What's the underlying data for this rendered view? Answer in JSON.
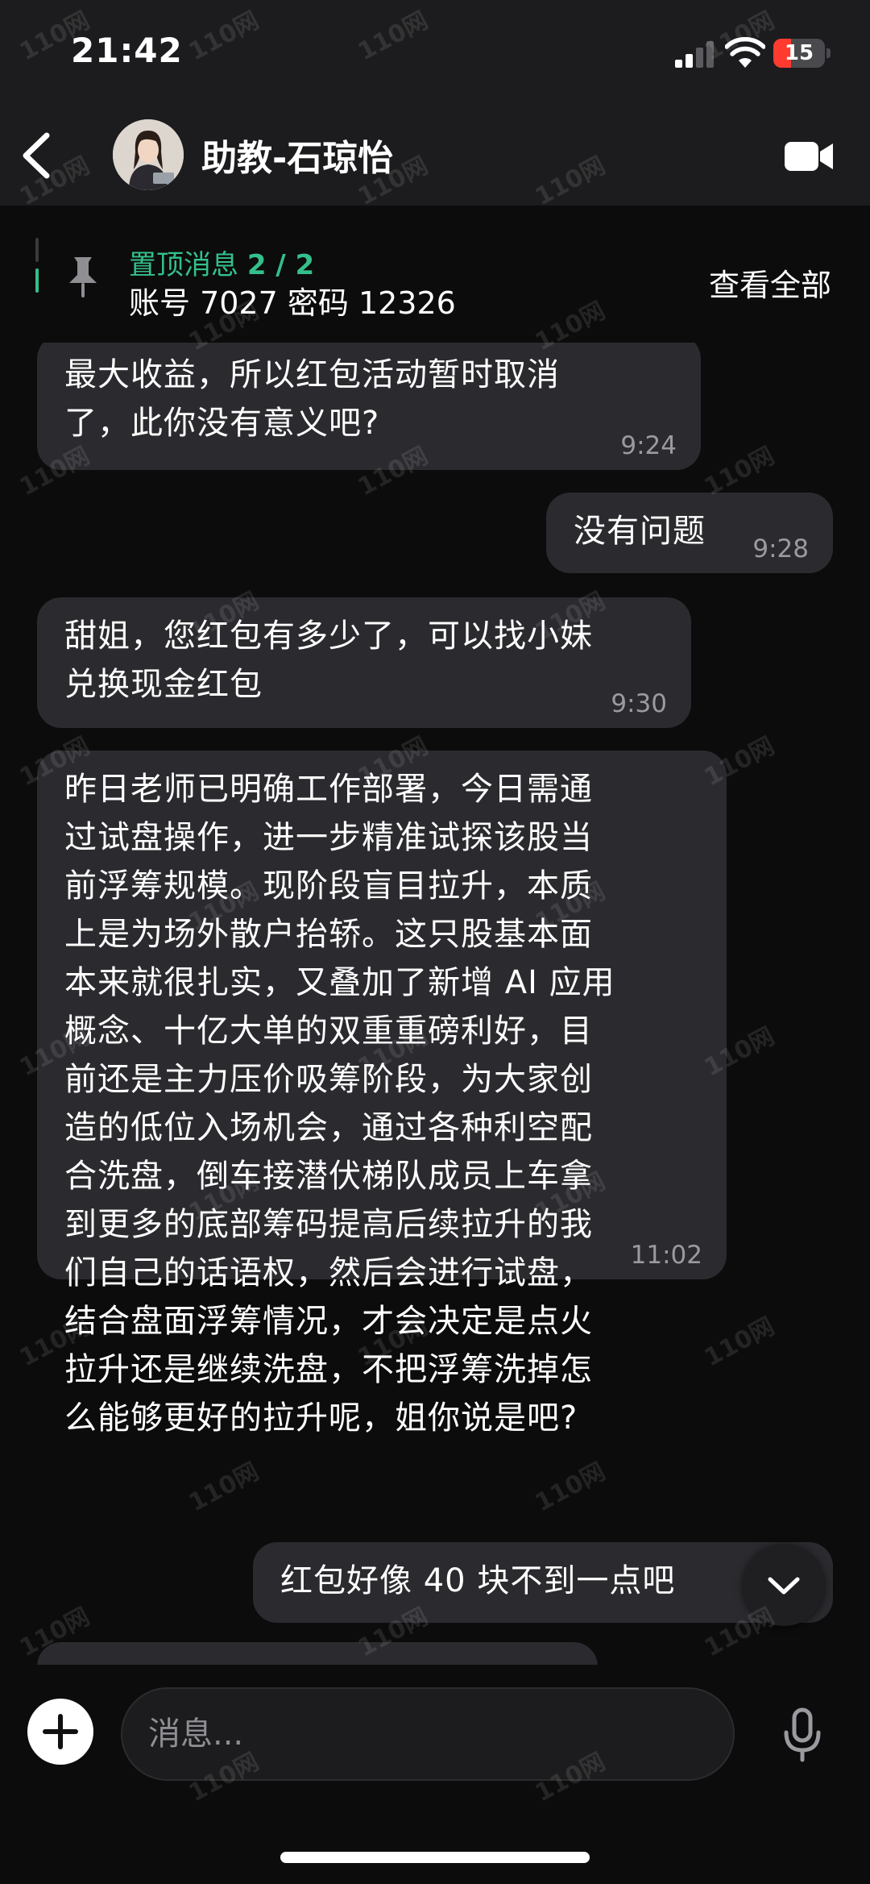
{
  "status_bar": {
    "time": "21:42",
    "battery_level": "15"
  },
  "header": {
    "contact_name": "助教-石琼怡"
  },
  "pinned": {
    "label": "置顶消息",
    "counter": "2 / 2",
    "text": "账号 7027 密码 12326",
    "view_all_label": "查看全部"
  },
  "messages": [
    {
      "direction": "incoming",
      "text": "最大收益，所以红包活动暂时取消\n了，此你没有意义吧?",
      "time": "9:24"
    },
    {
      "direction": "outgoing",
      "text": "没有问题",
      "time": "9:28"
    },
    {
      "direction": "incoming",
      "text": "甜姐，您红包有多少了，可以找小妹\n兑换现金红包",
      "time": "9:30"
    },
    {
      "direction": "incoming",
      "text": "昨日老师已明确工作部署，今日需通\n过试盘操作，进一步精准试探该股当\n前浮筹规模。现阶段盲目拉升，本质\n上是为场外散户抬轿。这只股基本面\n本来就很扎实，又叠加了新增 AI 应用\n概念、十亿大单的双重重磅利好，目\n前还是主力压价吸筹阶段，为大家创\n造的低位入场机会，通过各种利空配\n合洗盘，倒车接潜伏梯队成员上车拿\n到更多的底部筹码提高后续拉升的我\n们自己的话语权，然后会进行试盘，\n结合盘面浮筹情况，才会决定是点火\n拉升还是继续洗盘，不把浮筹洗掉怎\n么能够更好的拉升呢，姐你说是吧?",
      "time": "11:02"
    },
    {
      "direction": "outgoing",
      "text": "红包好像 40 块不到一点吧",
      "time": ""
    }
  ],
  "input": {
    "placeholder": "消息..."
  },
  "watermark_text": "110网",
  "colors": {
    "accent": "#34c08a",
    "bubble": "#2b2b2f",
    "header_bg": "#1c1c1e",
    "background": "#0c0c0d",
    "battery_low": "#ff3b30"
  },
  "icons": {
    "back": "chevron-left-icon",
    "video": "video-camera-icon",
    "pin": "pin-icon",
    "attach": "plus-icon",
    "mic": "microphone-icon",
    "scroll": "chevron-down-icon"
  }
}
